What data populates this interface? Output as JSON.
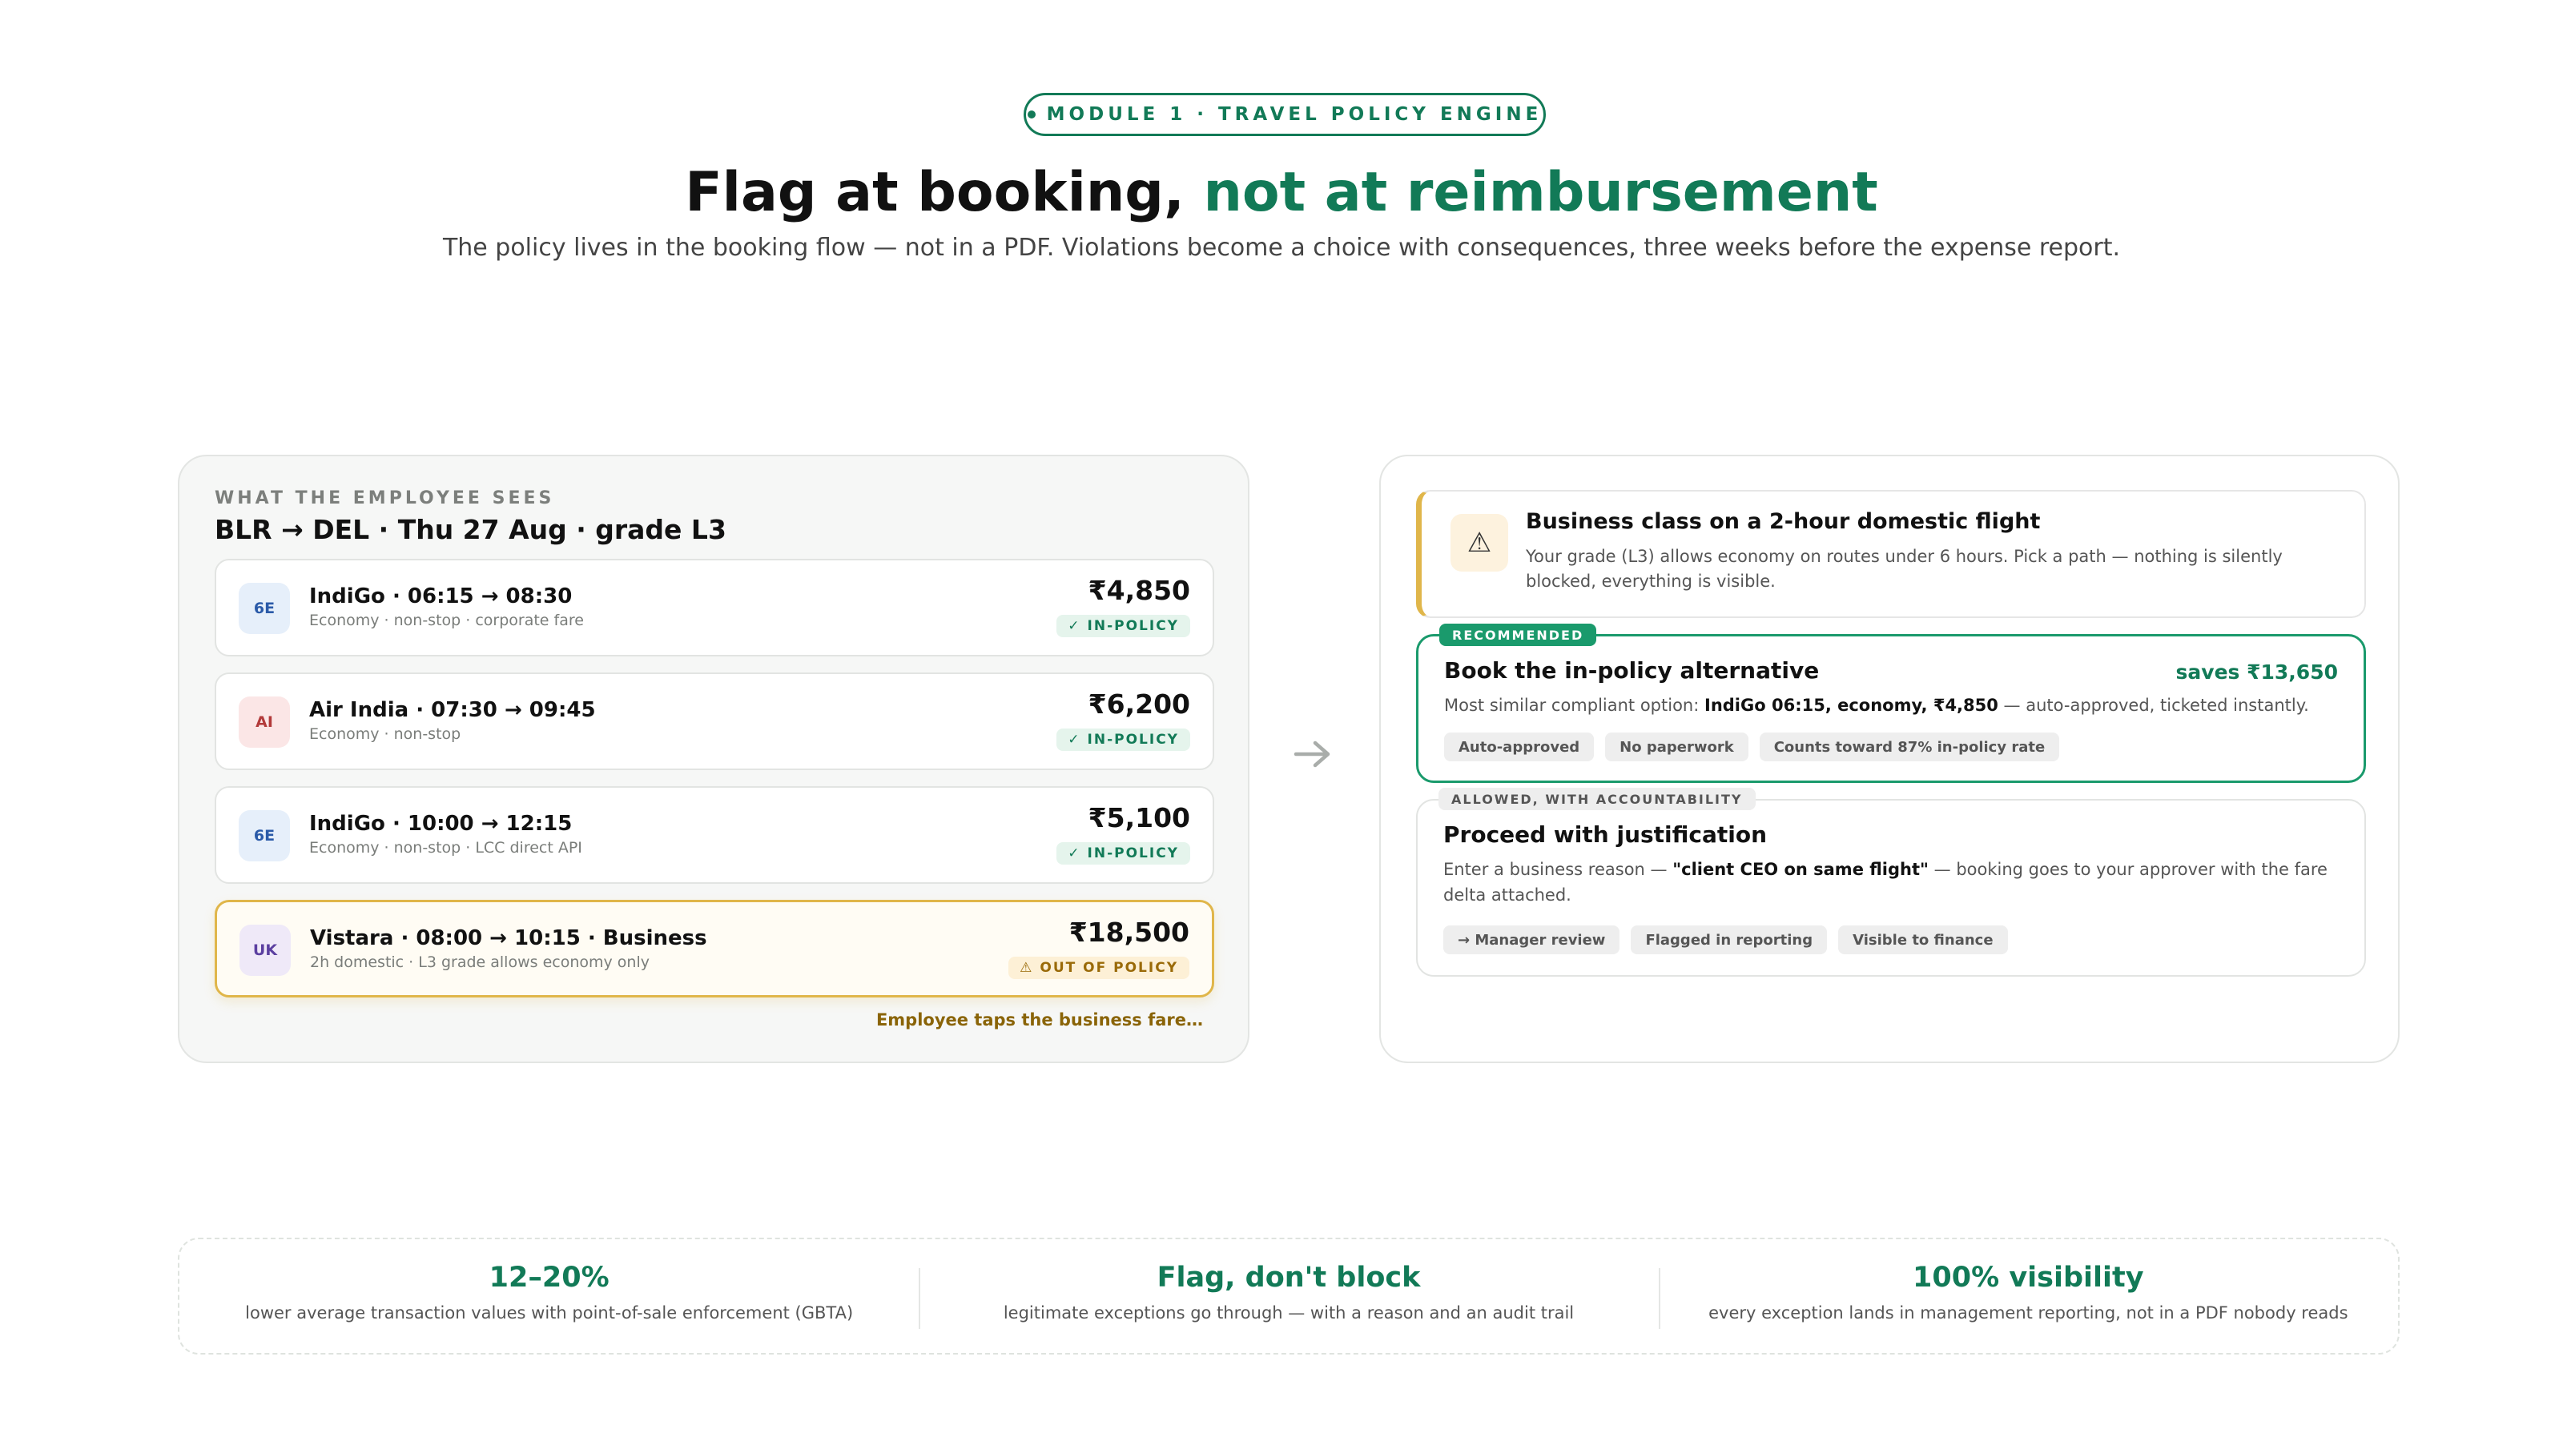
{
  "header": {
    "module_label": "MODULE 1 · TRAVEL POLICY ENGINE",
    "headline_main": "Flag at booking,",
    "headline_accent": "not at reimbursement",
    "subheadline": "The policy lives in the booking flow — not in a PDF. Violations become a choice with consequences, three weeks before the expense report."
  },
  "employee_view": {
    "eyebrow": "WHAT THE EMPLOYEE SEES",
    "route": "BLR → DEL · Thu 27 Aug · grade L3",
    "flights": [
      {
        "code": "6E",
        "title": "IndiGo · 06:15 → 08:30",
        "details": "Economy · non-stop · corporate fare",
        "price": "₹4,850",
        "status": "IN-POLICY",
        "status_icon": "✓"
      },
      {
        "code": "AI",
        "title": "Air India · 07:30 → 09:45",
        "details": "Economy · non-stop",
        "price": "₹6,200",
        "status": "IN-POLICY",
        "status_icon": "✓"
      },
      {
        "code": "6E",
        "title": "IndiGo · 10:00 → 12:15",
        "details": "Economy · non-stop · LCC direct API",
        "price": "₹5,100",
        "status": "IN-POLICY",
        "status_icon": "✓"
      },
      {
        "code": "UK",
        "title": "Vistara · 08:00 → 10:15 · Business",
        "details": "2h domestic · L3 grade allows economy only",
        "price": "₹18,500",
        "status": "OUT OF POLICY",
        "status_icon": "⚠"
      }
    ],
    "tap_note": "Employee taps the business fare…"
  },
  "policy_response": {
    "alert": {
      "icon": "⚠",
      "title": "Business class on a 2-hour domestic flight",
      "body": "Your grade (L3) allows economy on routes under 6 hours. Pick a path — nothing is silently blocked, everything is visible."
    },
    "recommended": {
      "tag": "RECOMMENDED",
      "title": "Book the in-policy alternative",
      "saves": "saves ₹13,650",
      "body_prefix": "Most similar compliant option: ",
      "body_bold": "IndiGo 06:15, economy, ₹4,850",
      "body_suffix": " — auto-approved, ticketed instantly.",
      "chips": [
        "Auto-approved",
        "No paperwork",
        "Counts toward 87% in-policy rate"
      ]
    },
    "justification": {
      "tag": "ALLOWED, WITH ACCOUNTABILITY",
      "title": "Proceed with justification",
      "body_prefix": "Enter a business reason — ",
      "body_bold": "\"client CEO on same flight\"",
      "body_suffix": " — booking goes to your approver with the fare delta attached.",
      "chips": [
        "→ Manager review",
        "Flagged in reporting",
        "Visible to finance"
      ]
    }
  },
  "stats": [
    {
      "value": "12–20%",
      "label": "lower average transaction values with point-of-sale enforcement (GBTA)"
    },
    {
      "value": "Flag, don't block",
      "label": "legitimate exceptions go through — with a reason and an audit trail"
    },
    {
      "value": "100% visibility",
      "label": "every exception lands in management reporting, not in a PDF nobody reads"
    }
  ],
  "colors": {
    "accent_green": "#127a57",
    "warning_amber": "#e0b64a",
    "badge_6e_bg": "#e6effa",
    "badge_ai_bg": "#fbe6e6",
    "badge_uk_bg": "#efe9f8"
  }
}
